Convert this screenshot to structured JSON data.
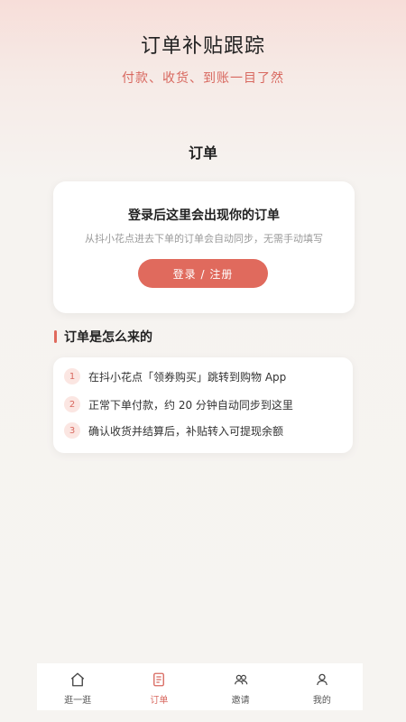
{
  "header": {
    "title": "订单补贴跟踪",
    "subtitle": "付款、收货、到账一目了然"
  },
  "section_title": "订单",
  "login_card": {
    "title": "登录后这里会出现你的订单",
    "description": "从抖小花点进去下单的订单会自动同步，无需手动填写",
    "button_label": "登录 / 注册"
  },
  "how": {
    "title": "订单是怎么来的",
    "steps": [
      {
        "num": "1",
        "text": "在抖小花点「领券购买」跳转到购物 App"
      },
      {
        "num": "2",
        "text": "正常下单付款，约 20 分钟自动同步到这里"
      },
      {
        "num": "3",
        "text": "确认收货并结算后，补贴转入可提现余额"
      }
    ]
  },
  "tabbar": {
    "items": [
      {
        "label": "逛一逛",
        "icon": "home-icon",
        "active": false
      },
      {
        "label": "订单",
        "icon": "order-icon",
        "active": true
      },
      {
        "label": "邀请",
        "icon": "invite-icon",
        "active": false
      },
      {
        "label": "我的",
        "icon": "profile-icon",
        "active": false
      }
    ]
  },
  "colors": {
    "accent": "#e06a5d",
    "background": "#f6f4f1"
  }
}
